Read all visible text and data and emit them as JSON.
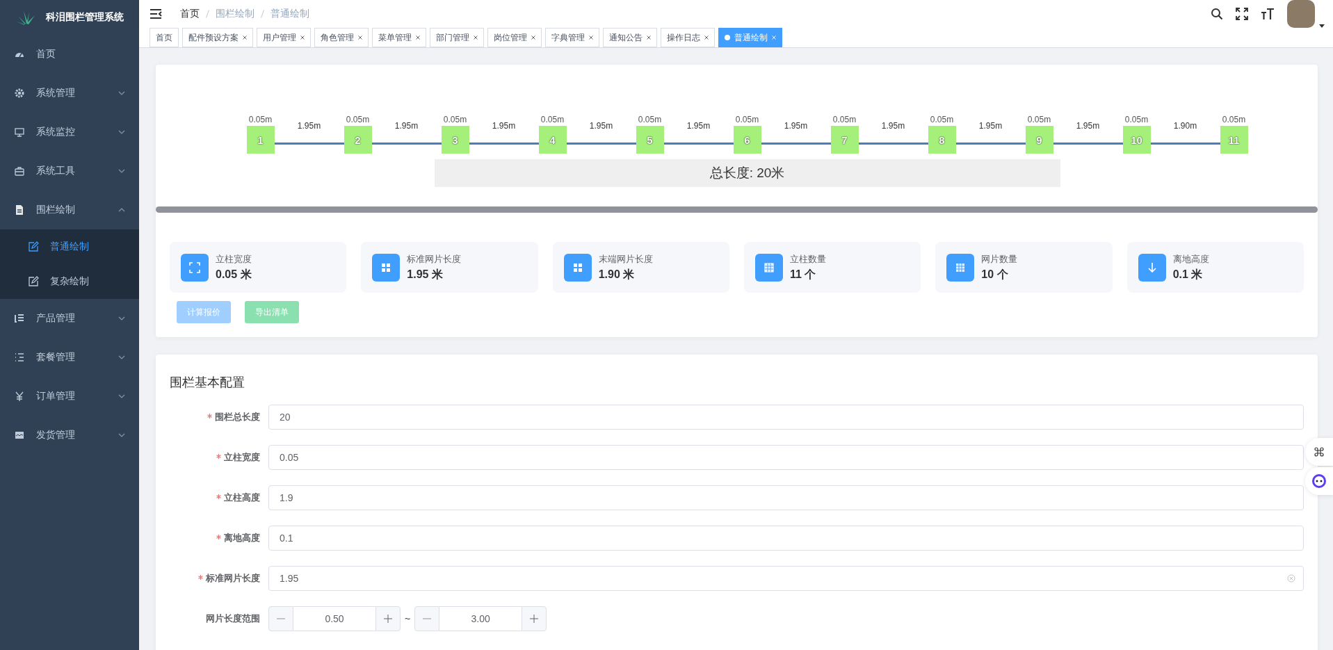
{
  "sidebar": {
    "title": "科泪围栏管理系统",
    "items": [
      {
        "label": "首页",
        "selected": false
      },
      {
        "label": "系统管理",
        "expanded": false,
        "selected": false
      },
      {
        "label": "系统监控",
        "expanded": false,
        "selected": false
      },
      {
        "label": "系统工具",
        "expanded": false,
        "selected": false
      },
      {
        "label": "围栏绘制",
        "expanded": true,
        "selected": false,
        "children": [
          {
            "label": "普通绘制",
            "selected": true
          },
          {
            "label": "复杂绘制",
            "selected": false
          }
        ]
      },
      {
        "label": "产品管理",
        "expanded": false,
        "selected": false
      },
      {
        "label": "套餐管理",
        "expanded": false,
        "selected": false
      },
      {
        "label": "订单管理",
        "expanded": false,
        "selected": false
      },
      {
        "label": "发货管理",
        "expanded": false,
        "selected": false
      }
    ]
  },
  "breadcrumb": [
    "首页",
    "围栏绘制",
    "普通绘制"
  ],
  "tabs": [
    {
      "label": "首页",
      "selected": false,
      "closable": false
    },
    {
      "label": "配件预设方案",
      "selected": false,
      "closable": true
    },
    {
      "label": "用户管理",
      "selected": false,
      "closable": true
    },
    {
      "label": "角色管理",
      "selected": false,
      "closable": true
    },
    {
      "label": "菜单管理",
      "selected": false,
      "closable": true
    },
    {
      "label": "部门管理",
      "selected": false,
      "closable": true
    },
    {
      "label": "岗位管理",
      "selected": false,
      "closable": true
    },
    {
      "label": "字典管理",
      "selected": false,
      "closable": true
    },
    {
      "label": "通知公告",
      "selected": false,
      "closable": true
    },
    {
      "label": "操作日志",
      "selected": false,
      "closable": true
    },
    {
      "label": "普通绘制",
      "selected": true,
      "closable": true
    }
  ],
  "diagram": {
    "posts": [
      {
        "number": "1",
        "width": "0.05m"
      },
      {
        "number": "2",
        "width": "0.05m"
      },
      {
        "number": "3",
        "width": "0.05m"
      },
      {
        "number": "4",
        "width": "0.05m"
      },
      {
        "number": "5",
        "width": "0.05m"
      },
      {
        "number": "6",
        "width": "0.05m"
      },
      {
        "number": "7",
        "width": "0.05m"
      },
      {
        "number": "8",
        "width": "0.05m"
      },
      {
        "number": "9",
        "width": "0.05m"
      },
      {
        "number": "10",
        "width": "0.05m"
      },
      {
        "number": "11",
        "width": "0.05m"
      }
    ],
    "panels": [
      "1.95m",
      "1.95m",
      "1.95m",
      "1.95m",
      "1.95m",
      "1.95m",
      "1.95m",
      "1.95m",
      "1.95m",
      "1.90m"
    ],
    "total": "总长度: 20米"
  },
  "stats": [
    {
      "label": "立柱宽度",
      "value": "0.05 米"
    },
    {
      "label": "标准网片长度",
      "value": "1.95 米"
    },
    {
      "label": "末端网片长度",
      "value": "1.90 米"
    },
    {
      "label": "立柱数量",
      "value": "11 个"
    },
    {
      "label": "网片数量",
      "value": "10 个"
    },
    {
      "label": "离地高度",
      "value": "0.1 米"
    }
  ],
  "actions": [
    {
      "label": "计算报价",
      "kind": "primary",
      "disabled": true
    },
    {
      "label": "导出清单",
      "kind": "success",
      "disabled": true
    }
  ],
  "form": {
    "title": "围栏基本配置",
    "fields": [
      {
        "kind": "input",
        "label": "围栏总长度",
        "required": true,
        "value": "20",
        "clear_icon": false
      },
      {
        "kind": "input",
        "label": "立柱宽度",
        "required": true,
        "value": "0.05",
        "clear_icon": false
      },
      {
        "kind": "input",
        "label": "立柱高度",
        "required": true,
        "value": "1.9",
        "clear_icon": false
      },
      {
        "kind": "input",
        "label": "离地高度",
        "required": true,
        "value": "0.1",
        "clear_icon": false
      },
      {
        "kind": "input",
        "label": "标准网片长度",
        "required": true,
        "value": "1.95",
        "clear_icon": true
      },
      {
        "kind": "range",
        "label": "网片长度范围",
        "required": false,
        "min": "0.50",
        "separator": "~",
        "max": "3.00"
      }
    ]
  }
}
